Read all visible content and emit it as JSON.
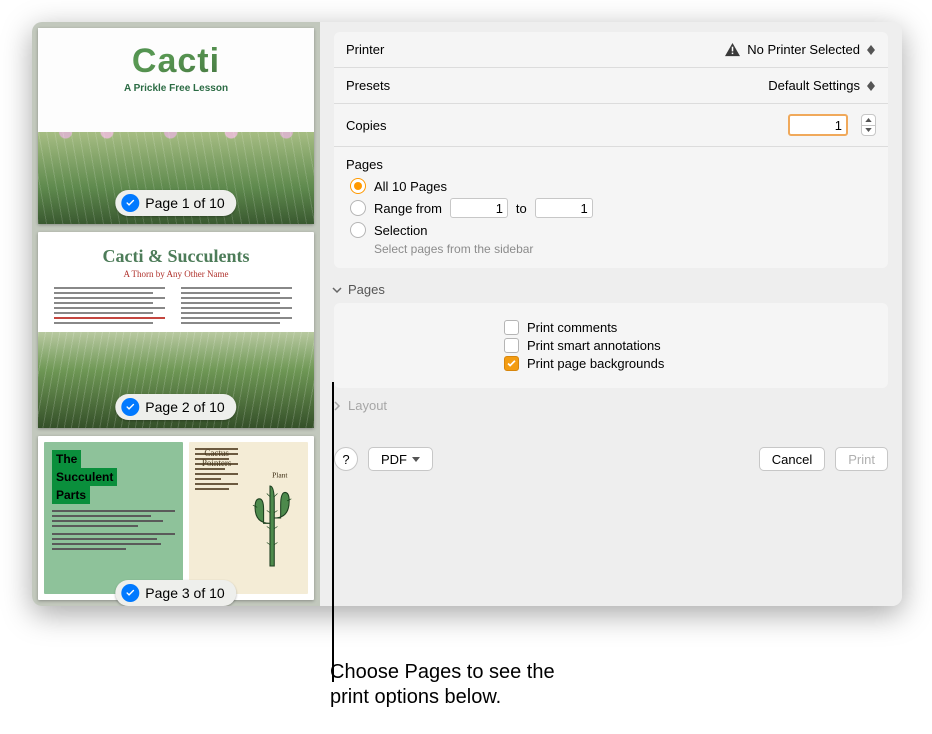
{
  "sidebar": {
    "pages": [
      {
        "badge": "Page 1 of 10"
      },
      {
        "badge": "Page 2 of 10"
      },
      {
        "badge": "Page 3 of 10"
      }
    ],
    "thumb1": {
      "title": "Cacti",
      "subtitle": "A Prickle Free Lesson"
    },
    "thumb2": {
      "title": "Cacti & Succulents",
      "subtitle": "A Thorn by Any Other Name"
    },
    "thumb3": {
      "titleA1": "The",
      "titleA2": "Succulent",
      "titleA3": "Parts",
      "titleB": "Cactus Pointers",
      "plant_label": "Plant"
    }
  },
  "printer": {
    "label": "Printer",
    "value": "No Printer Selected"
  },
  "presets": {
    "label": "Presets",
    "value": "Default Settings"
  },
  "copies": {
    "label": "Copies",
    "value": "1"
  },
  "pages": {
    "label": "Pages",
    "all_label": "All 10 Pages",
    "range_label": "Range from",
    "range_from": "1",
    "range_to_label": "to",
    "range_to": "1",
    "selection_label": "Selection",
    "selection_hint": "Select pages from the sidebar"
  },
  "app_options": {
    "header": "Pages",
    "print_comments": "Print comments",
    "print_annotations": "Print smart annotations",
    "print_backgrounds": "Print page backgrounds"
  },
  "layout": {
    "header": "Layout"
  },
  "buttons": {
    "help": "?",
    "pdf": "PDF",
    "cancel": "Cancel",
    "print": "Print"
  },
  "callout": {
    "line1": "Choose Pages to see the",
    "line2": "print options below."
  }
}
